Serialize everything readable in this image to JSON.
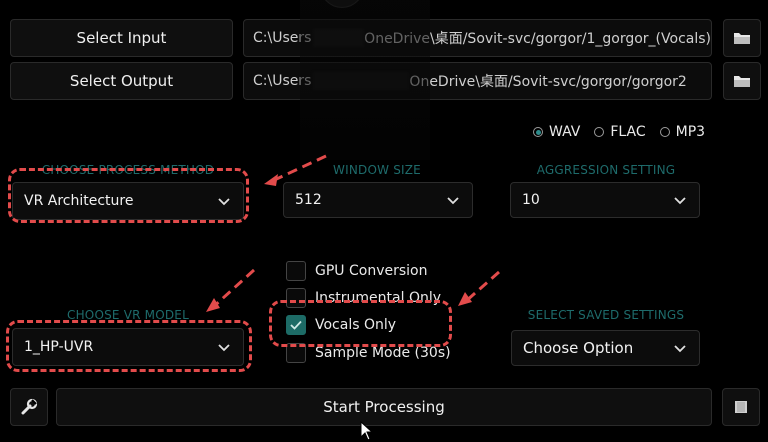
{
  "top": {
    "select_input_label": "Select Input",
    "select_output_label": "Select Output",
    "input_path_prefix": "C:\\Users",
    "input_path_faint": "",
    "input_path_suffix": "OneDrive\\桌面/Sovit-svc/gorgor/1_gorgor_(Vocals)",
    "output_path_prefix": "C:\\Users",
    "output_path_suffix": "OneDrive\\桌面/Sovit-svc/gorgor/gorgor2"
  },
  "format": {
    "options": [
      "WAV",
      "FLAC",
      "MP3"
    ],
    "selected": "WAV"
  },
  "settings": {
    "process_method_label": "CHOOSE PROCESS METHOD",
    "process_method_value": "VR Architecture",
    "window_size_label": "WINDOW SIZE",
    "window_size_value": "512",
    "aggression_label": "AGGRESSION SETTING",
    "aggression_value": "10",
    "vr_model_label": "CHOOSE VR MODEL",
    "vr_model_value": "1_HP-UVR",
    "saved_settings_label": "SELECT SAVED SETTINGS",
    "saved_settings_value": "Choose Option"
  },
  "options": {
    "gpu": {
      "label": "GPU Conversion",
      "checked": false
    },
    "instrumental": {
      "label": "Instrumental Only",
      "checked": false
    },
    "vocals": {
      "label": "Vocals Only",
      "checked": true
    },
    "sample": {
      "label": "Sample Mode (30s)",
      "checked": false
    }
  },
  "bottom": {
    "start_label": "Start Processing"
  },
  "colors": {
    "accent_teal": "#1d6b66",
    "annotation_red": "#e24b4b"
  },
  "icons": [
    "folder-icon",
    "wrench-icon",
    "stop-icon",
    "chevron-down-icon",
    "checkmark-icon",
    "cursor-icon",
    "arrow-annotation"
  ]
}
